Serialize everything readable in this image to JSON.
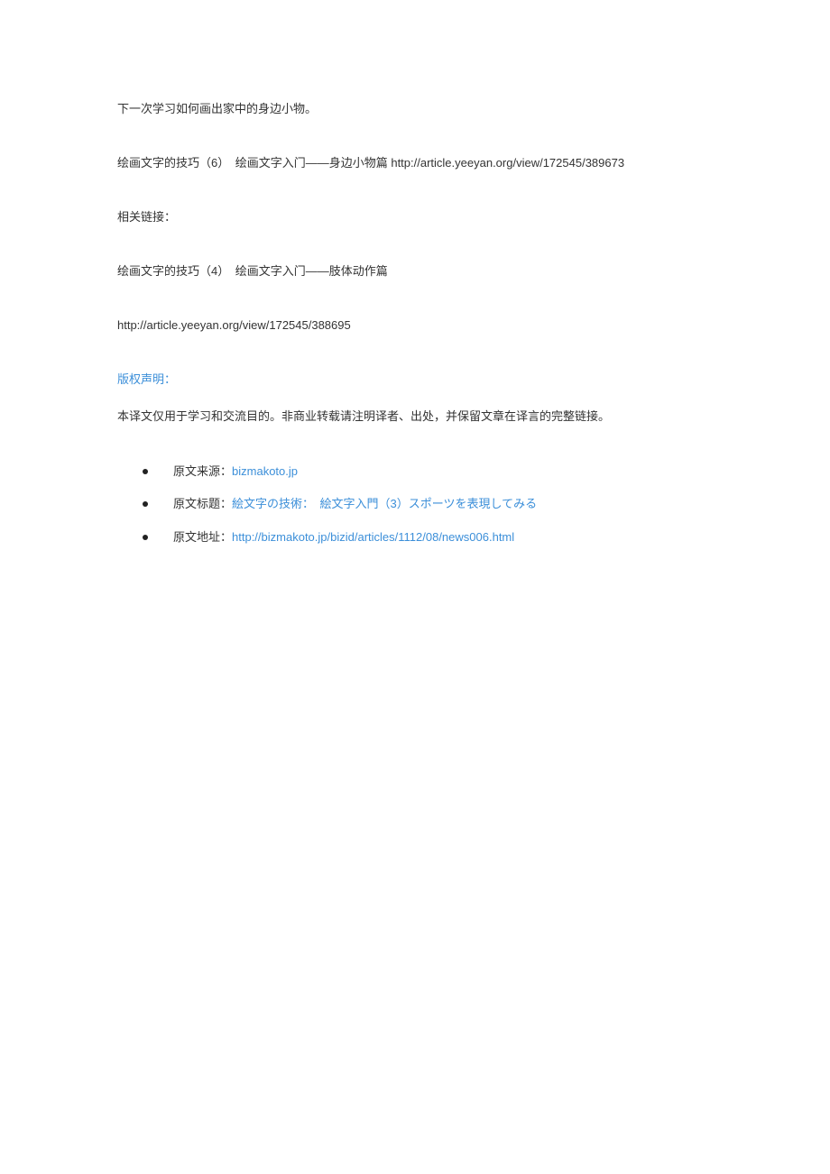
{
  "body": {
    "p1": "下一次学习如何画出家中的身边小物。",
    "p2": "绘画文字的技巧（6）　绘画文字入门——身边小物篇 http://article.yeeyan.org/view/172545/389673",
    "p3": "相关链接：",
    "p4": "绘画文字的技巧（4）　绘画文字入门——肢体动作篇",
    "p5": "http://article.yeeyan.org/view/172545/388695",
    "copyright_heading": "版权声明：",
    "copyright_body": "本译文仅用于学习和交流目的。非商业转载请注明译者、出处，并保留文章在译言的完整链接。"
  },
  "refs": {
    "source_label": "原文来源：",
    "source_link": "bizmakoto.jp",
    "title_label": "原文标题：",
    "title_link": "絵文字の技術：　絵文字入門（3）スポーツを表現してみる",
    "url_label": "原文地址：",
    "url_link": "http://bizmakoto.jp/bizid/articles/1112/08/news006.html"
  }
}
